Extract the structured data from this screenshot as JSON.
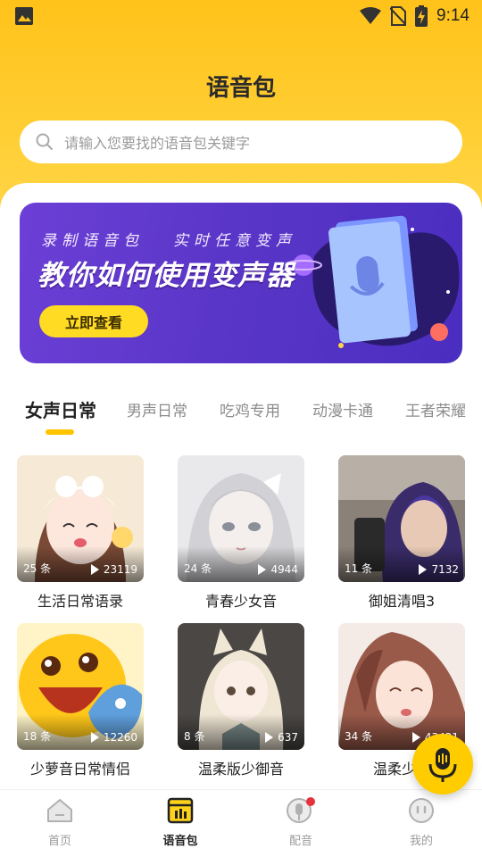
{
  "status_bar": {
    "time": "9:14"
  },
  "page_title": "语音包",
  "search": {
    "placeholder": "请输入您要找的语音包关键字"
  },
  "banner": {
    "subtitle_left": "录制语音包",
    "subtitle_right": "实时任意变声",
    "title": "教你如何使用变声器",
    "button_label": "立即查看"
  },
  "tabs": [
    {
      "label": "女声日常",
      "active": true
    },
    {
      "label": "男声日常",
      "active": false
    },
    {
      "label": "吃鸡专用",
      "active": false
    },
    {
      "label": "动漫卡通",
      "active": false
    },
    {
      "label": "王者荣耀",
      "active": false
    }
  ],
  "cards": [
    {
      "title": "生活日常语录",
      "count": "25 条",
      "plays": "23119"
    },
    {
      "title": "青春少女音",
      "count": "24 条",
      "plays": "4944"
    },
    {
      "title": "御姐清唱3",
      "count": "11 条",
      "plays": "7132"
    },
    {
      "title": "少萝音日常情侣",
      "count": "18 条",
      "plays": "12260"
    },
    {
      "title": "温柔版少御音",
      "count": "8 条",
      "plays": "637"
    },
    {
      "title": "温柔少御",
      "count": "34 条",
      "plays": "43421"
    }
  ],
  "bottom_nav": [
    {
      "label": "首页",
      "icon": "home-icon",
      "active": false
    },
    {
      "label": "语音包",
      "icon": "voice-pack-icon",
      "active": true
    },
    {
      "label": "配音",
      "icon": "microphone-icon",
      "active": false
    },
    {
      "label": "我的",
      "icon": "profile-icon",
      "active": false
    }
  ],
  "colors": {
    "accent": "#ffc400",
    "banner": "#5a36c8",
    "badge": "#e6323c"
  }
}
